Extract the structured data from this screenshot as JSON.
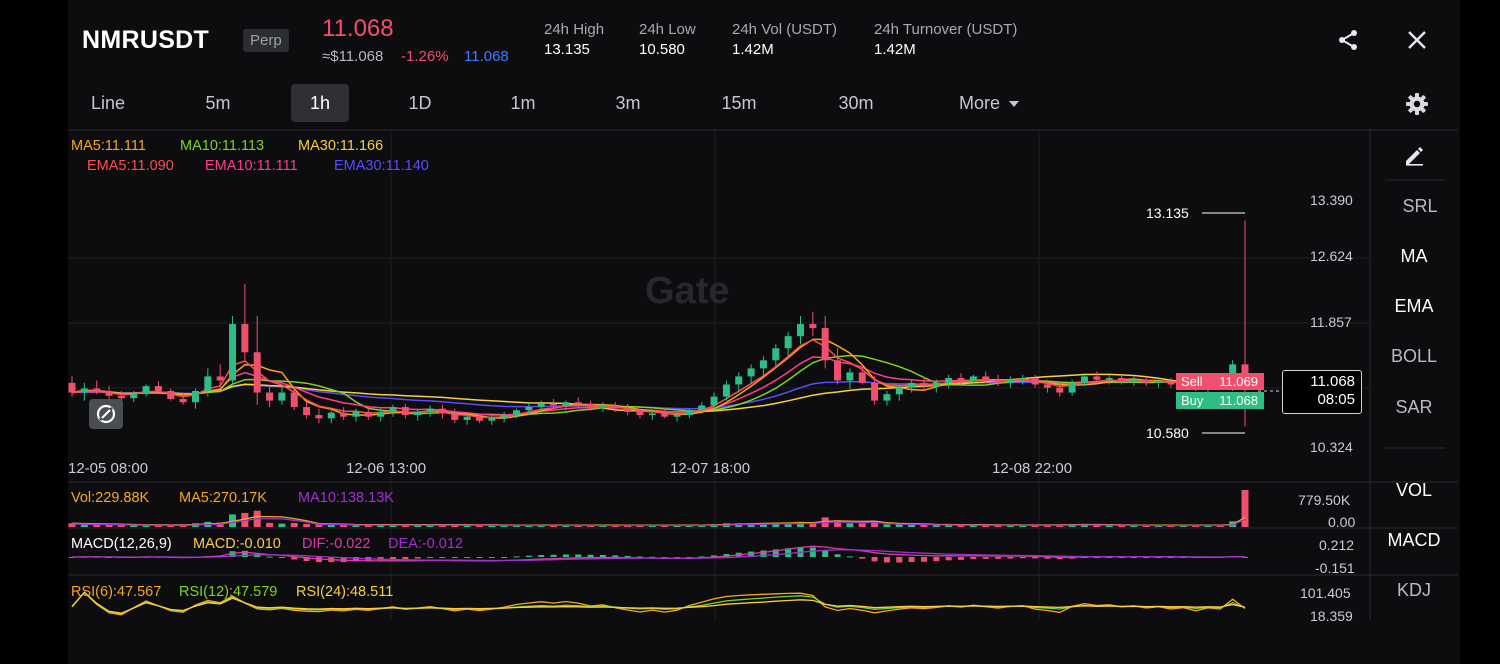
{
  "header": {
    "symbol": "NMRUSDT",
    "badge": "Perp",
    "last_price": "11.068",
    "usd_price": "≈$11.068",
    "change_pct": "-1.26%",
    "mark_price": "11.068",
    "stats": [
      {
        "label": "24h High",
        "value": "13.135"
      },
      {
        "label": "24h Low",
        "value": "10.580"
      },
      {
        "label": "24h Vol (USDT)",
        "value": "1.42M"
      },
      {
        "label": "24h Turnover (USDT)",
        "value": "1.42M"
      }
    ],
    "share_icon": "share-icon",
    "close_icon": "close-icon"
  },
  "intervals": {
    "items": [
      "Line",
      "5m",
      "1h",
      "1D",
      "1m",
      "3m",
      "15m",
      "30m",
      "More"
    ],
    "active": "1h",
    "more_icon": "caret-down-icon",
    "settings_icon": "gear-icon"
  },
  "main_legend": {
    "ma": [
      "MA5:11.111",
      "MA10:11.113",
      "MA30:11.166"
    ],
    "ema": [
      "EMA5:11.090",
      "EMA10:11.111",
      "EMA30:11.140"
    ]
  },
  "price_axis": [
    "13.390",
    "12.624",
    "11.857",
    "10.324"
  ],
  "time_axis": [
    "12-05 08:00",
    "12-06 13:00",
    "12-07 18:00",
    "12-08 22:00"
  ],
  "high_marker": "13.135",
  "low_marker": "10.580",
  "order_tags": {
    "sell_label": "Sell",
    "sell_value": "11.069",
    "buy_label": "Buy",
    "buy_value": "11.068"
  },
  "current_price_box": {
    "price": "11.068",
    "countdown": "08:05"
  },
  "watermark": "Gate",
  "sidebar": {
    "draw_icon": "pencil-icon",
    "main_indicators": [
      "SRL",
      "MA",
      "EMA",
      "BOLL",
      "SAR"
    ],
    "sub_indicators": [
      "VOL",
      "MACD",
      "KDJ"
    ]
  },
  "volume": {
    "legend": [
      "Vol:229.88K",
      "MA5:270.17K",
      "MA10:138.13K"
    ],
    "axis": [
      "779.50K",
      "0.00"
    ]
  },
  "macd": {
    "legend": [
      "MACD(12,26,9)",
      "MACD:-0.010",
      "DIF:-0.022",
      "DEA:-0.012"
    ],
    "axis": [
      "0.212",
      "-0.151"
    ]
  },
  "rsi": {
    "legend": [
      "RSI(6):47.567",
      "RSI(12):47.579",
      "RSI(24):48.511"
    ],
    "axis": [
      "101.405",
      "18.359"
    ]
  },
  "colors": {
    "up": "#2ebd85",
    "down": "#f0506e",
    "ma5": "#f5a623",
    "ma10": "#7ed321",
    "ma30": "#f8d03d",
    "ema5": "#ff4d4f",
    "ema10": "#ff3d8b",
    "ema30": "#5b4bff",
    "mark": "#3d7dff",
    "macd_dif": "#d63ea8",
    "macd_dea": "#a030d0"
  },
  "chart_data": {
    "type": "candlestick",
    "x_ticks": [
      "12-05 08:00",
      "12-06 13:00",
      "12-07 18:00",
      "12-08 22:00"
    ],
    "y_ticks": [
      13.39,
      12.624,
      11.857,
      10.324
    ],
    "ylim": [
      10.324,
      13.39
    ],
    "high": 13.135,
    "low": 10.58,
    "last": 11.068,
    "ohlc": [
      [
        11.12,
        11.2,
        10.95,
        11.0
      ],
      [
        11.0,
        11.12,
        10.9,
        11.05
      ],
      [
        11.05,
        11.15,
        10.98,
        11.02
      ],
      [
        11.02,
        11.08,
        10.92,
        10.96
      ],
      [
        10.96,
        11.02,
        10.88,
        10.93
      ],
      [
        10.93,
        11.02,
        10.88,
        10.98
      ],
      [
        10.98,
        11.1,
        10.95,
        11.08
      ],
      [
        11.08,
        11.14,
        11.0,
        11.02
      ],
      [
        11.02,
        11.05,
        10.9,
        10.92
      ],
      [
        10.92,
        11.0,
        10.85,
        10.88
      ],
      [
        10.88,
        11.05,
        10.8,
        11.02
      ],
      [
        11.02,
        11.3,
        10.95,
        11.2
      ],
      [
        11.2,
        11.35,
        11.05,
        11.15
      ],
      [
        11.15,
        11.95,
        11.1,
        11.85
      ],
      [
        11.85,
        12.35,
        11.4,
        11.5
      ],
      [
        11.5,
        11.95,
        10.85,
        11.0
      ],
      [
        11.0,
        11.1,
        10.82,
        10.9
      ],
      [
        10.9,
        11.08,
        10.85,
        11.0
      ],
      [
        11.0,
        11.05,
        10.78,
        10.82
      ],
      [
        10.82,
        10.88,
        10.68,
        10.72
      ],
      [
        10.72,
        10.8,
        10.62,
        10.68
      ],
      [
        10.68,
        10.78,
        10.62,
        10.75
      ],
      [
        10.75,
        10.82,
        10.66,
        10.7
      ],
      [
        10.7,
        10.8,
        10.64,
        10.76
      ],
      [
        10.76,
        10.82,
        10.66,
        10.7
      ],
      [
        10.7,
        10.8,
        10.64,
        10.76
      ],
      [
        10.76,
        10.85,
        10.7,
        10.82
      ],
      [
        10.82,
        10.86,
        10.68,
        10.72
      ],
      [
        10.72,
        10.8,
        10.65,
        10.76
      ],
      [
        10.76,
        10.84,
        10.7,
        10.8
      ],
      [
        10.8,
        10.85,
        10.68,
        10.74
      ],
      [
        10.74,
        10.8,
        10.62,
        10.66
      ],
      [
        10.66,
        10.74,
        10.6,
        10.7
      ],
      [
        10.7,
        10.74,
        10.62,
        10.65
      ],
      [
        10.65,
        10.72,
        10.6,
        10.68
      ],
      [
        10.68,
        10.76,
        10.63,
        10.72
      ],
      [
        10.72,
        10.8,
        10.68,
        10.78
      ],
      [
        10.78,
        10.86,
        10.72,
        10.82
      ],
      [
        10.82,
        10.9,
        10.75,
        10.86
      ],
      [
        10.86,
        10.92,
        10.8,
        10.84
      ],
      [
        10.84,
        10.9,
        10.78,
        10.88
      ],
      [
        10.88,
        10.94,
        10.82,
        10.86
      ],
      [
        10.86,
        10.9,
        10.78,
        10.82
      ],
      [
        10.82,
        10.88,
        10.76,
        10.84
      ],
      [
        10.84,
        10.88,
        10.76,
        10.8
      ],
      [
        10.8,
        10.86,
        10.72,
        10.76
      ],
      [
        10.76,
        10.8,
        10.68,
        10.72
      ],
      [
        10.72,
        10.78,
        10.66,
        10.74
      ],
      [
        10.74,
        10.8,
        10.68,
        10.7
      ],
      [
        10.7,
        10.76,
        10.64,
        10.72
      ],
      [
        10.72,
        10.8,
        10.68,
        10.78
      ],
      [
        10.78,
        10.88,
        10.74,
        10.84
      ],
      [
        10.84,
        11.0,
        10.8,
        10.95
      ],
      [
        10.95,
        11.15,
        10.9,
        11.1
      ],
      [
        11.1,
        11.25,
        11.0,
        11.2
      ],
      [
        11.2,
        11.35,
        11.1,
        11.3
      ],
      [
        11.3,
        11.45,
        11.2,
        11.4
      ],
      [
        11.4,
        11.6,
        11.3,
        11.55
      ],
      [
        11.55,
        11.75,
        11.45,
        11.7
      ],
      [
        11.7,
        11.95,
        11.6,
        11.85
      ],
      [
        11.85,
        12.0,
        11.7,
        11.8
      ],
      [
        11.8,
        11.95,
        11.3,
        11.4
      ],
      [
        11.4,
        11.55,
        11.1,
        11.15
      ],
      [
        11.15,
        11.3,
        11.05,
        11.25
      ],
      [
        11.25,
        11.35,
        11.1,
        11.12
      ],
      [
        11.12,
        11.2,
        10.85,
        10.9
      ],
      [
        10.9,
        11.02,
        10.84,
        10.98
      ],
      [
        10.98,
        11.1,
        10.9,
        11.06
      ],
      [
        11.06,
        11.15,
        11.0,
        11.12
      ],
      [
        11.12,
        11.2,
        11.02,
        11.08
      ],
      [
        11.08,
        11.16,
        11.0,
        11.12
      ],
      [
        11.12,
        11.22,
        11.05,
        11.18
      ],
      [
        11.18,
        11.24,
        11.08,
        11.14
      ],
      [
        11.14,
        11.22,
        11.08,
        11.2
      ],
      [
        11.2,
        11.26,
        11.12,
        11.16
      ],
      [
        11.16,
        11.22,
        11.08,
        11.12
      ],
      [
        11.12,
        11.2,
        11.06,
        11.16
      ],
      [
        11.16,
        11.22,
        11.1,
        11.18
      ],
      [
        11.18,
        11.22,
        11.06,
        11.1
      ],
      [
        11.1,
        11.16,
        11.0,
        11.06
      ],
      [
        11.06,
        11.12,
        10.95,
        11.0
      ],
      [
        11.0,
        11.16,
        10.96,
        11.12
      ],
      [
        11.12,
        11.24,
        11.08,
        11.2
      ],
      [
        11.2,
        11.26,
        11.12,
        11.16
      ],
      [
        11.16,
        11.22,
        11.1,
        11.18
      ],
      [
        11.18,
        11.22,
        11.1,
        11.14
      ],
      [
        11.14,
        11.2,
        11.08,
        11.16
      ],
      [
        11.16,
        11.2,
        11.08,
        11.12
      ],
      [
        11.12,
        11.18,
        11.06,
        11.14
      ],
      [
        11.14,
        11.18,
        11.06,
        11.1
      ],
      [
        11.1,
        11.16,
        11.04,
        11.12
      ],
      [
        11.12,
        11.16,
        11.02,
        11.06
      ],
      [
        11.06,
        11.12,
        11.0,
        11.1
      ],
      [
        11.1,
        11.16,
        11.04,
        11.08
      ],
      [
        11.08,
        11.4,
        11.02,
        11.35
      ],
      [
        11.35,
        13.135,
        10.58,
        11.068
      ]
    ]
  }
}
